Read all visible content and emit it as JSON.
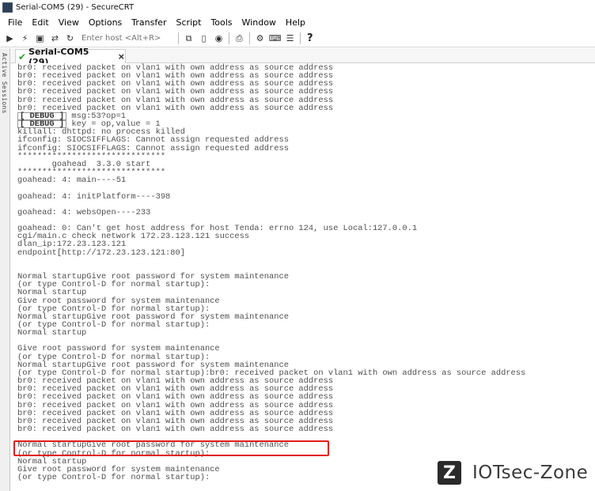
{
  "window": {
    "title": "Serial-COM5 (29) - SecureCRT"
  },
  "menu": [
    "File",
    "Edit",
    "View",
    "Options",
    "Transfer",
    "Script",
    "Tools",
    "Window",
    "Help"
  ],
  "toolbar": {
    "host_placeholder": "Enter host <Alt+R>"
  },
  "side_panel": {
    "label": "Active Sessions"
  },
  "tab": {
    "label": "Serial-COM5 (29)",
    "close": "×"
  },
  "terminal": {
    "lines": [
      {
        "text": "br0: received packet on vlan1 with own address as source address"
      },
      {
        "text": "br0: received packet on vlan1 with own address as source address"
      },
      {
        "text": "br0: received packet on vlan1 with own address as source address"
      },
      {
        "text": "br0: received packet on vlan1 with own address as source address"
      },
      {
        "text": "br0: received packet on vlan1 with own address as source address"
      },
      {
        "text": "br0: received packet on vlan1 with own address as source address"
      },
      {
        "tag": "[ DEBUG ]",
        "text": " msg:53?op=1"
      },
      {
        "tag": "[ DEBUG ]",
        "text": " key = op,value = 1"
      },
      {
        "text": "killall: dhttpd: no process killed"
      },
      {
        "text": "ifconfig: SIOCSIFFLAGS: Cannot assign requested address"
      },
      {
        "text": "ifconfig: SIOCSIFFLAGS: Cannot assign requested address"
      },
      {
        "text": "******************************"
      },
      {
        "text": "       goahead  3.3.0 start"
      },
      {
        "text": "******************************"
      },
      {
        "text": "goahead: 4: main----51"
      },
      {
        "text": ""
      },
      {
        "text": "goahead: 4: initPlatform----398"
      },
      {
        "text": ""
      },
      {
        "text": "goahead: 4: websOpen----233"
      },
      {
        "text": ""
      },
      {
        "text": "goahead: 0: Can't get host address for host Tenda: errno 124, use Local:127.0.0.1"
      },
      {
        "text": "cgi/main.c check network 172.23.123.121 success"
      },
      {
        "text": "dlan_ip:172.23.123.121"
      },
      {
        "text": "endpoint[http://172.23.123.121:80]"
      },
      {
        "text": ""
      },
      {
        "text": ""
      },
      {
        "text": "Normal startupGive root password for system maintenance"
      },
      {
        "text": "(or type Control-D for normal startup):"
      },
      {
        "text": "Normal startup"
      },
      {
        "text": "Give root password for system maintenance"
      },
      {
        "text": "(or type Control-D for normal startup):"
      },
      {
        "text": "Normal startupGive root password for system maintenance"
      },
      {
        "text": "(or type Control-D for normal startup):"
      },
      {
        "text": "Normal startup"
      },
      {
        "text": ""
      },
      {
        "text": "Give root password for system maintenance"
      },
      {
        "text": "(or type Control-D for normal startup):"
      },
      {
        "text": "Normal startupGive root password for system maintenance"
      },
      {
        "text": "(or type Control-D for normal startup):br0: received packet on vlan1 with own address as source address"
      },
      {
        "text": "br0: received packet on vlan1 with own address as source address"
      },
      {
        "text": "br0: received packet on vlan1 with own address as source address"
      },
      {
        "text": "br0: received packet on vlan1 with own address as source address"
      },
      {
        "text": "br0: received packet on vlan1 with own address as source address"
      },
      {
        "text": "br0: received packet on vlan1 with own address as source address"
      },
      {
        "text": "br0: received packet on vlan1 with own address as source address"
      },
      {
        "text": "br0: received packet on vlan1 with own address as source address"
      },
      {
        "text": ""
      },
      {
        "text": "Normal startupGive root password for system maintenance"
      },
      {
        "text": "(or type Control-D for normal startup):"
      },
      {
        "text": "Normal startup"
      },
      {
        "text": "Give root password for system maintenance"
      },
      {
        "text": "(or type Control-D for normal startup):"
      }
    ]
  },
  "colors": {
    "highlight": "#e31b1b",
    "terminal_text": "#4f4f4f",
    "check": "#2d9a2d"
  },
  "watermark": {
    "logo_letter": "Z",
    "text": "IOTsec-Zone"
  }
}
